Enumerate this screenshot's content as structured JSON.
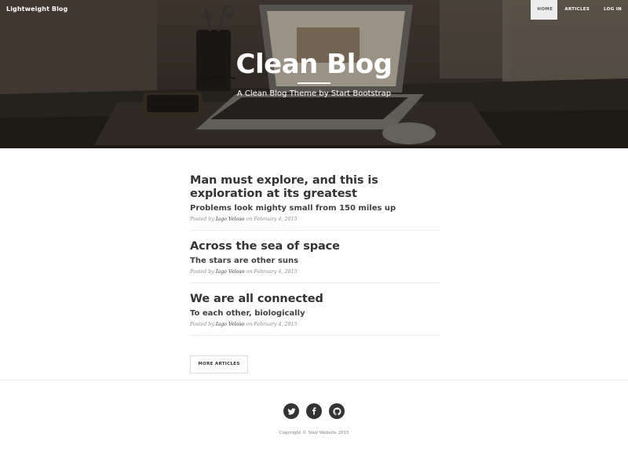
{
  "navbar": {
    "brand": "Lightweight Blog",
    "items": [
      {
        "label": "Home",
        "active": true
      },
      {
        "label": "Articles",
        "active": false
      },
      {
        "label": "Log in",
        "active": false
      }
    ]
  },
  "hero": {
    "title": "Clean Blog",
    "subtitle": "A Clean Blog Theme by Start Bootstrap"
  },
  "posts": [
    {
      "title": "Man must explore, and this is exploration at its greatest",
      "subtitle": "Problems look mighty small from 150 miles up",
      "meta_prefix": "Posted by",
      "author": "Iago Veloso",
      "date_text": "on February 4, 2015"
    },
    {
      "title": "Across the sea of space",
      "subtitle": "The stars are other suns",
      "meta_prefix": "Posted by",
      "author": "Iago Veloso",
      "date_text": "on February 4, 2015"
    },
    {
      "title": "We are all connected",
      "subtitle": "To each other, biologically",
      "meta_prefix": "Posted by",
      "author": "Iago Veloso",
      "date_text": "on February 4, 2015"
    }
  ],
  "more_button": "More Articles",
  "footer": {
    "social": [
      {
        "icon": "twitter-icon"
      },
      {
        "icon": "facebook-icon"
      },
      {
        "icon": "github-icon"
      }
    ],
    "copyright": "Copyright © Your Website 2015"
  },
  "colors": {
    "text_dark": "#333333",
    "meta_gray": "#8c8c8c",
    "social_bg": "#333333",
    "nav_active_bg": "#ededed"
  }
}
